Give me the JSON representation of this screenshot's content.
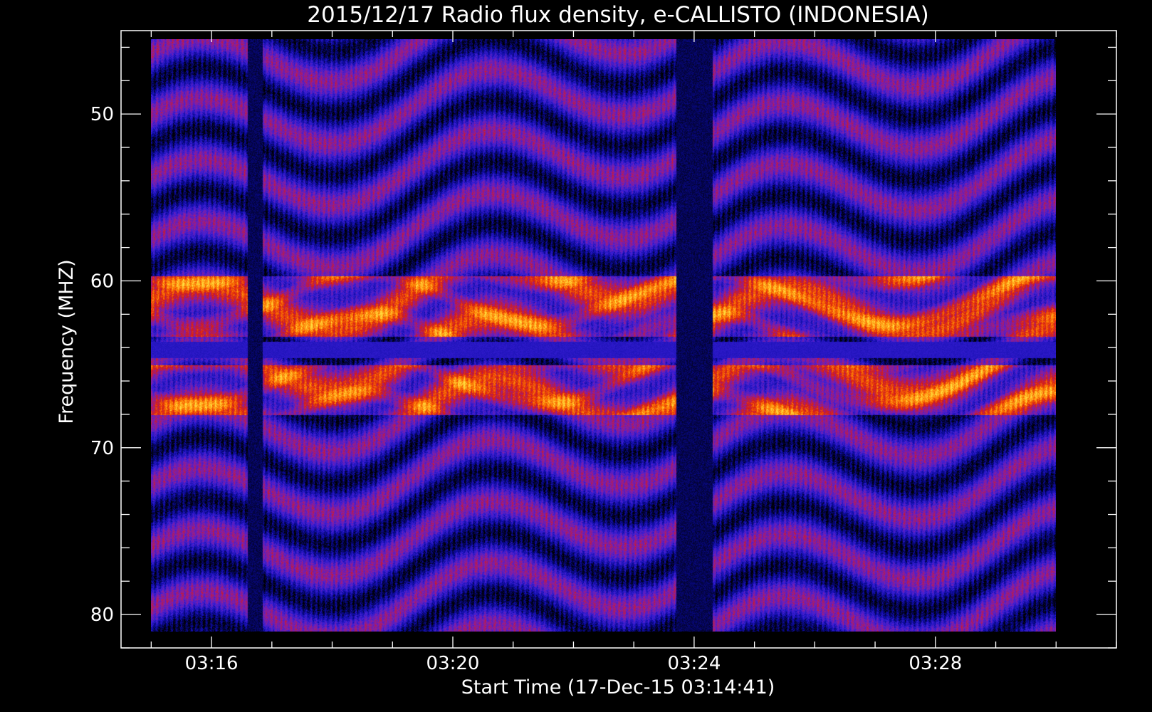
{
  "chart_data": {
    "type": "heatmap",
    "title": "2015/12/17  Radio flux density, e-CALLISTO (INDONESIA)",
    "xlabel": "Start Time (17-Dec-15 03:14:41)",
    "ylabel": "Frequency (MHZ)",
    "x_ticks": [
      "03:16",
      "03:20",
      "03:24",
      "03:28"
    ],
    "x_tick_minutes": [
      16,
      20,
      24,
      28
    ],
    "x_range_minutes": [
      14.5,
      31.0
    ],
    "y_ticks": [
      "50",
      "60",
      "70",
      "80"
    ],
    "y_tick_values": [
      50,
      60,
      70,
      80
    ],
    "ylim": [
      45.0,
      82.0
    ],
    "data_time_range_minutes": [
      15.0,
      30.0
    ],
    "data_freq_range_mhz": [
      45.5,
      81.0
    ],
    "gaps_minutes": [
      [
        16.6,
        16.85
      ],
      [
        23.7,
        24.3
      ]
    ],
    "bright_bands_mhz": [
      [
        59.7,
        63.3
      ],
      [
        65.0,
        68.0
      ]
    ],
    "dark_band_mhz": [
      63.6,
      64.6
    ],
    "colormap": [
      "#000000",
      "#0a0aa0",
      "#3a1fd8",
      "#8a1fa0",
      "#d81a12",
      "#ff7a00",
      "#ffe040"
    ],
    "grid": false,
    "legend": "none"
  }
}
